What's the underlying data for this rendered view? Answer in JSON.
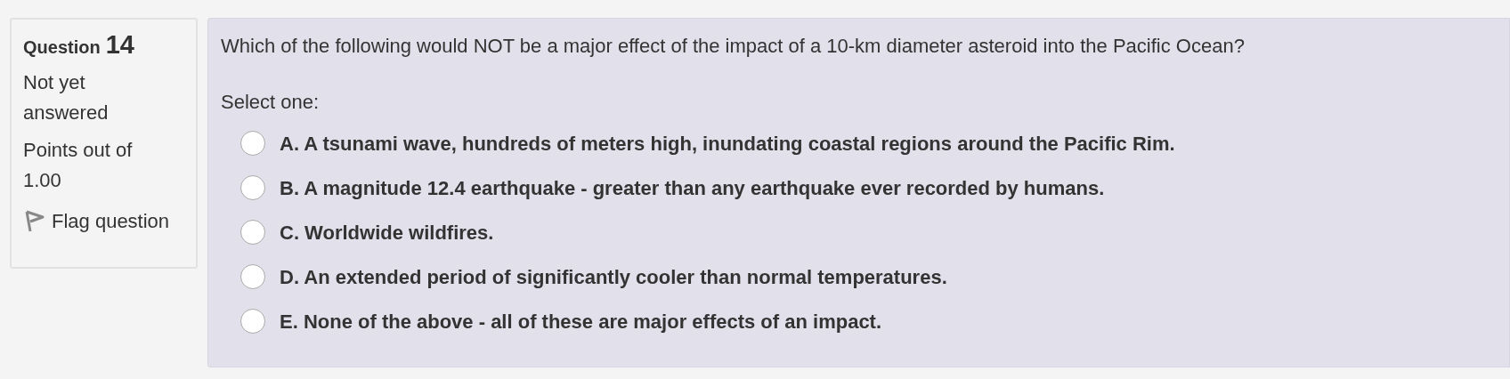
{
  "info": {
    "label": "Question",
    "number": "14",
    "state": "Not yet answered",
    "grade": "Points out of 1.00",
    "flag": {
      "label": "Flag question",
      "flagged": false
    }
  },
  "question": {
    "text": "Which of the following would NOT be a major effect of the impact of a 10-km diameter asteroid into the Pacific Ocean?",
    "prompt": "Select one:",
    "options": [
      {
        "label": "A. A tsunami wave, hundreds of meters high, inundating coastal regions around the Pacific Rim.",
        "selected": false
      },
      {
        "label": "B. A magnitude 12.4 earthquake - greater than any earthquake ever recorded by humans.",
        "selected": false
      },
      {
        "label": "C. Worldwide wildfires.",
        "selected": false
      },
      {
        "label": "D. An extended period of significantly cooler than normal temperatures.",
        "selected": false
      },
      {
        "label": "E. None of the above - all of these are major effects of an impact.",
        "selected": false
      }
    ]
  }
}
